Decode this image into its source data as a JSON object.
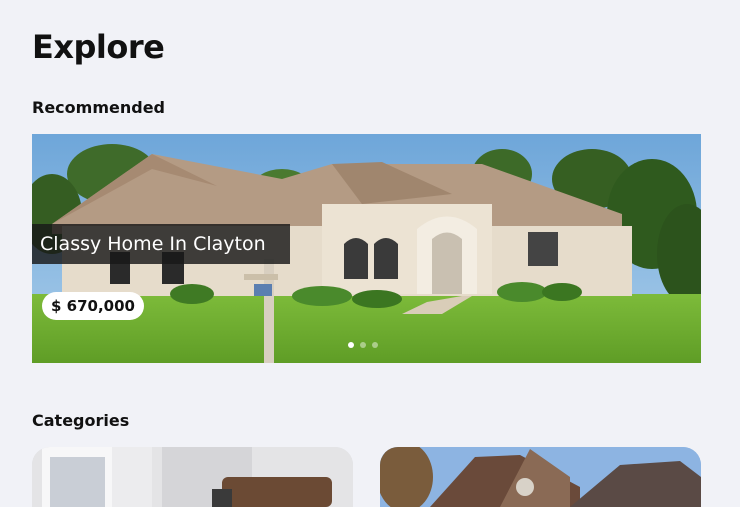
{
  "page": {
    "title": "Explore"
  },
  "recommended": {
    "heading": "Recommended",
    "card": {
      "title": "Classy Home In Clayton",
      "price": "$ 670,000"
    },
    "carousel": {
      "slide_count": 3,
      "active_index": 0
    }
  },
  "categories": {
    "heading": "Categories"
  },
  "colors": {
    "background": "#f1f2f7",
    "title_overlay": "#191919",
    "price_pill": "#ffffff"
  }
}
